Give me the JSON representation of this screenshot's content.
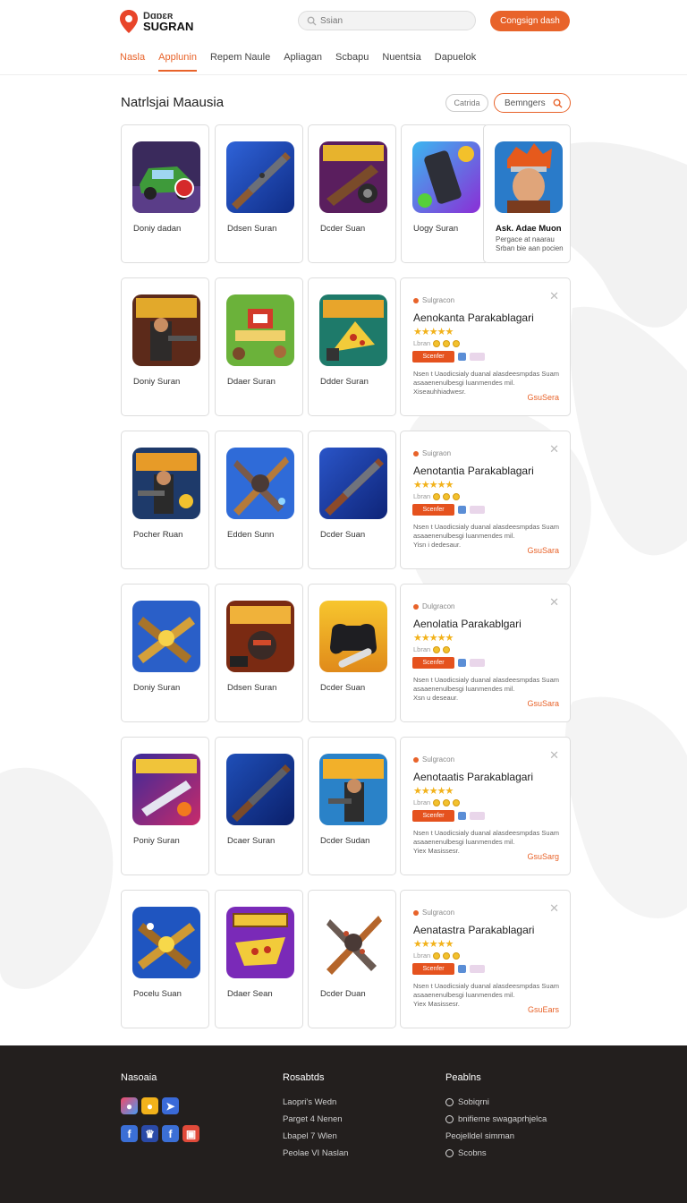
{
  "header": {
    "logo_line1": "Dɑɒɛʀ",
    "logo_line2": "SUGRAN",
    "search_placeholder": "Ssian",
    "cta_label": "Congsign dash"
  },
  "nav": [
    "Nasla",
    "Applunin",
    "Repem Naule",
    "Apliagan",
    "Scbapu",
    "Nuentsia",
    "Dapuelok"
  ],
  "main": {
    "title": "Natrlsjai Maausia",
    "filter_label": "Catrida",
    "sort_label": "Bemngers"
  },
  "rows": [
    {
      "apps": [
        {
          "name": "Doniy dadan",
          "icon": "green-car-icon"
        },
        {
          "name": "Ddsen Suran",
          "icon": "sword-blue-icon"
        },
        {
          "name": "Dcder Suan",
          "icon": "gun-title-icon"
        },
        {
          "name": "Uogy Suran",
          "icon": "phone-purple-icon"
        },
        {
          "name": "Ask. Adae Muon",
          "sub1": "Pergace at naarau",
          "sub2": "Srban bie aan pocien",
          "icon": "warrior-portrait-icon"
        }
      ]
    },
    {
      "apps": [
        {
          "name": "Doniy Suran",
          "icon": "soldier-action-icon"
        },
        {
          "name": "Ddaer Suran",
          "icon": "farm-game-icon"
        },
        {
          "name": "Ddder Suran",
          "icon": "pizza-slice-icon"
        }
      ],
      "promo": {
        "kicker": "Sulgracon",
        "title": "Aenokanta Parakablagari",
        "meta": "Lbran",
        "install": "Scenfer",
        "desc1": "Nsen t Uaodicsialy duanal alasdeesmpdas Suam",
        "desc2": "asaaenenulbesgi luanmendes mil.",
        "desc3": "Xiseauhhiadwesr.",
        "link": "GsuSera"
      }
    },
    {
      "apps": [
        {
          "name": "Pocher Ruan",
          "icon": "soldier-action-icon-2"
        },
        {
          "name": "Edden Sunn",
          "icon": "cross-weapon-icon"
        },
        {
          "name": "Dcder Suan",
          "icon": "sword-blue-icon-2"
        }
      ],
      "promo": {
        "kicker": "Suigraon",
        "title": "Aenotantia Parakablagari",
        "meta": "Lbran",
        "install": "Scenfer",
        "desc1": "Nsen t Uaodicsialy duanal alasdeesmpdas Suam",
        "desc2": "asaaenenulbesgi luanmendes mil.",
        "desc3": "Yisn i dedesaur.",
        "link": "GsuSara"
      }
    },
    {
      "apps": [
        {
          "name": "Doniy Suran",
          "icon": "cross-cannon-icon"
        },
        {
          "name": "Ddsen Suran",
          "icon": "robot-title-icon"
        },
        {
          "name": "Dcder Suan",
          "icon": "gamepad-icon"
        }
      ],
      "promo": {
        "kicker": "Dulgracon",
        "title": "Aenolatia Parakablgari",
        "meta": "Lbran",
        "install": "Scenfer",
        "desc1": "Nsen t Uaodicsialy duanal alasdeesmpdas Suam",
        "desc2": "asaaenenulbesgi luanmendes mil.",
        "desc3": "Xsn u deseaur.",
        "link": "GsuSara"
      }
    },
    {
      "apps": [
        {
          "name": "Poniy Suran",
          "icon": "space-battle-icon"
        },
        {
          "name": "Dcaer Suran",
          "icon": "sword-blue-icon-3"
        },
        {
          "name": "Dcder Sudan",
          "icon": "soldier-action-icon-3"
        }
      ],
      "promo": {
        "kicker": "Sulgracon",
        "title": "Aenotaatis Parakablagari",
        "meta": "Lbran",
        "install": "Scenfer",
        "desc1": "Nsen t Uaodicsialy duanal alasdeesmpdas Suam",
        "desc2": "asaaenenulbesgi luanmendes mil.",
        "desc3": "Yiex Masissesr.",
        "link": "GsuSarg"
      }
    },
    {
      "apps": [
        {
          "name": "Pocelu Suan",
          "icon": "cross-cannon-icon-2"
        },
        {
          "name": "Ddaer Sean",
          "icon": "pizza-title-icon"
        },
        {
          "name": "Dcder Duan",
          "icon": "cross-weapon-icon-2"
        }
      ],
      "promo": {
        "kicker": "Sulgracon",
        "title": "Aenatastra Parakablagari",
        "meta": "Lbran",
        "install": "Scenfer",
        "desc1": "Nsen t Uaodicsialy duanal alasdeesmpdas Suam",
        "desc2": "asaaenenulbesgi luanmendes mil.",
        "desc3": "Yiex Masissesr.",
        "link": "GsuEars"
      }
    }
  ],
  "footer": {
    "col1_heading": "Nasoaia",
    "col2_heading": "Rosabtds",
    "col2_links": [
      "Laopri's Wedn",
      "Parget 4 Nenen",
      "Lbapel 7 Wlen",
      "Peolae VI Naslan"
    ],
    "col3_heading": "Peablns",
    "col3_links": [
      "Sobiqrni",
      "bnifieme swagaprhjelca",
      "Peojelldel simman",
      "Scobns"
    ]
  },
  "colors": {
    "accent": "#e8632a",
    "footer_bg": "#231f1e",
    "star": "#f2b21b"
  }
}
